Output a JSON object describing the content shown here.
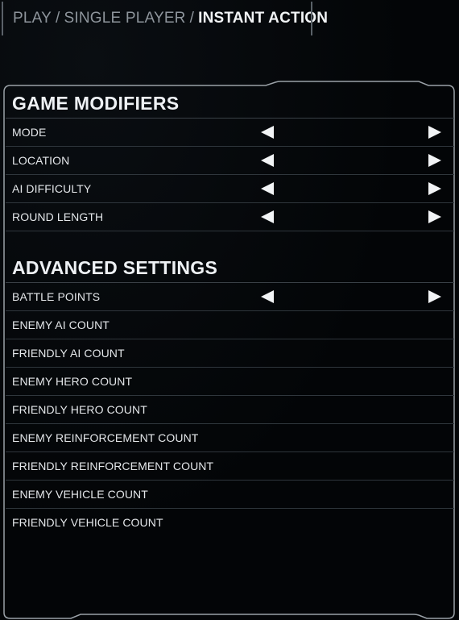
{
  "breadcrumb": {
    "items": [
      "PLAY",
      "SINGLE PLAYER",
      "INSTANT ACTION"
    ],
    "separator": "/"
  },
  "game_modifiers": {
    "title": "GAME MODIFIERS",
    "rows": [
      {
        "label": "MODE",
        "has_arrows": true
      },
      {
        "label": "LOCATION",
        "has_arrows": true
      },
      {
        "label": "AI DIFFICULTY",
        "has_arrows": true
      },
      {
        "label": "ROUND LENGTH",
        "has_arrows": true
      }
    ]
  },
  "advanced_settings": {
    "title": "ADVANCED SETTINGS",
    "rows": [
      {
        "label": "BATTLE POINTS",
        "has_arrows": true
      },
      {
        "label": "ENEMY AI COUNT",
        "has_arrows": false
      },
      {
        "label": "FRIENDLY AI COUNT",
        "has_arrows": false
      },
      {
        "label": "ENEMY HERO COUNT",
        "has_arrows": false
      },
      {
        "label": "FRIENDLY HERO COUNT",
        "has_arrows": false
      },
      {
        "label": "ENEMY REINFORCEMENT COUNT",
        "has_arrows": false
      },
      {
        "label": "FRIENDLY REINFORCEMENT COUNT",
        "has_arrows": false
      },
      {
        "label": "ENEMY VEHICLE COUNT",
        "has_arrows": false
      },
      {
        "label": "FRIENDLY VEHICLE COUNT",
        "has_arrows": false
      }
    ]
  },
  "icons": {
    "arrow_left": "left-arrow-icon",
    "arrow_right": "right-arrow-icon"
  },
  "colors": {
    "background": "#030507",
    "text": "#e6e9ec",
    "breadcrumb_inactive": "#8e959c",
    "divider": "#2f363c",
    "frame": "#9aa1a7"
  }
}
